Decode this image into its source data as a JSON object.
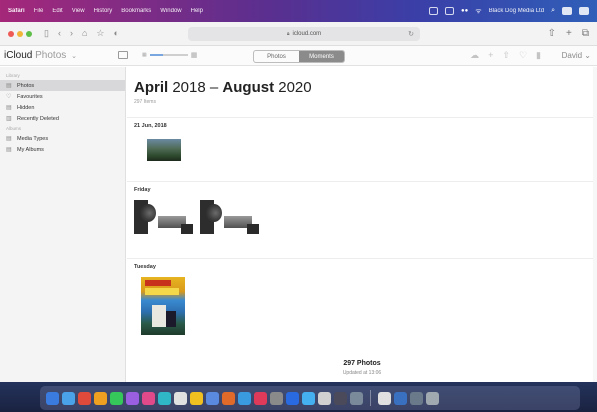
{
  "menubar": {
    "app": "Safari",
    "items": [
      "File",
      "Edit",
      "View",
      "History",
      "Bookmarks",
      "Window",
      "Help"
    ],
    "account": "Black Dog Media Ltd"
  },
  "browser": {
    "url": "icloud.com"
  },
  "icloud": {
    "title": "iCloud",
    "subtitle": "Photos",
    "views": [
      "Photos",
      "Moments"
    ],
    "active_view": "Moments",
    "user": "David",
    "zoom_level_fraction": 0.35
  },
  "sidebar": {
    "library_heading": "Library",
    "library_items": [
      {
        "label": "Photos",
        "icon": "photos-icon",
        "selected": true
      },
      {
        "label": "Favourites",
        "icon": "heart-icon",
        "selected": false
      },
      {
        "label": "Hidden",
        "icon": "hidden-icon",
        "selected": false
      },
      {
        "label": "Recently Deleted",
        "icon": "trash-icon",
        "selected": false
      }
    ],
    "albums_heading": "Albums",
    "album_items": [
      {
        "label": "Media Types",
        "icon": "folder-icon"
      },
      {
        "label": "My Albums",
        "icon": "folder-icon"
      }
    ]
  },
  "main": {
    "heading_start_month": "April",
    "heading_start_year": "2018",
    "heading_sep": "–",
    "heading_end_month": "August",
    "heading_end_year": "2020",
    "item_count": "297 Items",
    "sections": [
      {
        "label": "21 Jun, 2018"
      },
      {
        "label": "Friday"
      },
      {
        "label": "Tuesday"
      }
    ],
    "footer_count": "297 Photos",
    "footer_updated": "Updated at 13:06"
  },
  "dock": {
    "colors": [
      "#3a7be0",
      "#4aa3e8",
      "#e04a3a",
      "#f0a020",
      "#35c759",
      "#9a5fe0",
      "#e04a8a",
      "#2fb7c8",
      "#e0e0e0",
      "#f0c020",
      "#5a8ae0",
      "#e06a2a",
      "#3a9ae0",
      "#e03a5a",
      "#8a8a8a",
      "#2a6ae0",
      "#45b0f0",
      "#d0d0d0",
      "#4a4a5a",
      "#7a8a9a",
      "#e0e0e0",
      "#3a70c0",
      "#6a7a8a",
      "#a0a8b0"
    ]
  }
}
